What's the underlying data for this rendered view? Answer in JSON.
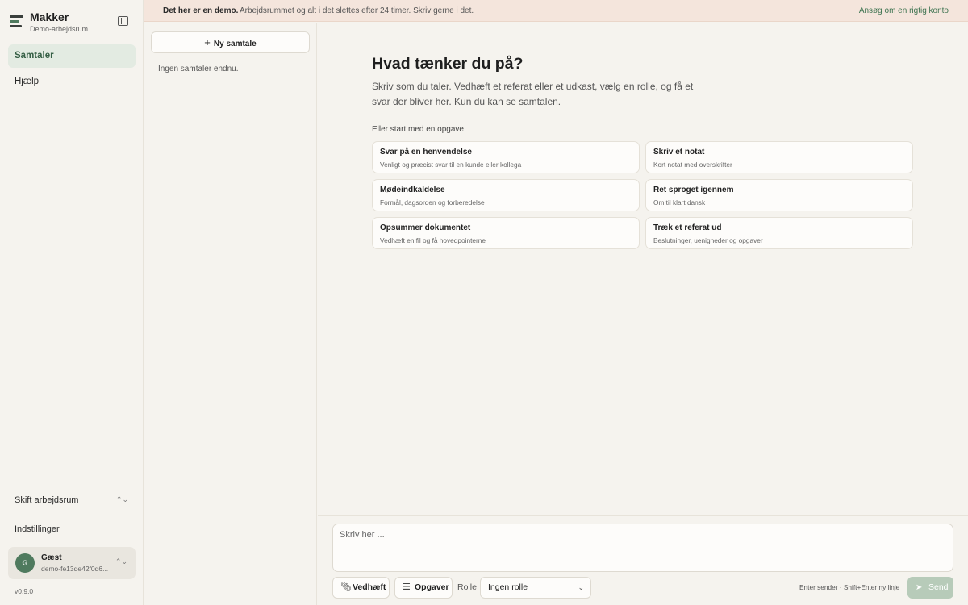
{
  "sidebar": {
    "brand_name": "Makker",
    "brand_sub": "Demo-arbejdsrum",
    "nav": [
      {
        "label": "Samtaler",
        "active": true
      },
      {
        "label": "Hjælp",
        "active": false
      }
    ],
    "switch_workspace": "Skift arbejdsrum",
    "settings": "Indstillinger",
    "user": {
      "initial": "G",
      "name": "Gæst",
      "id": "demo-fe13de42f0d6..."
    },
    "version": "v0.9.0"
  },
  "banner": {
    "strong": "Det her er en demo.",
    "text": "Arbejdsrummet og alt i det slettes efter 24 timer. Skriv gerne i det.",
    "link": "Ansøg om en rigtig konto"
  },
  "conversations": {
    "new_button": "Ny samtale",
    "empty": "Ingen samtaler endnu."
  },
  "main": {
    "title": "Hvad tænker du på?",
    "description": "Skriv som du taler. Vedhæft et referat eller et udkast, vælg en rolle, og få et svar der bliver her. Kun du kan se samtalen.",
    "start_label": "Eller start med en opgave",
    "tasks": [
      {
        "title": "Svar på en henvendelse",
        "sub": "Venligt og præcist svar til en kunde eller kollega"
      },
      {
        "title": "Skriv et notat",
        "sub": "Kort notat med overskrifter"
      },
      {
        "title": "Mødeindkaldelse",
        "sub": "Formål, dagsorden og forberedelse"
      },
      {
        "title": "Ret sproget igennem",
        "sub": "Om til klart dansk"
      },
      {
        "title": "Opsummer dokumentet",
        "sub": "Vedhæft en fil og få hovedpointerne"
      },
      {
        "title": "Træk et referat ud",
        "sub": "Beslutninger, uenigheder og opgaver"
      }
    ]
  },
  "composer": {
    "placeholder": "Skriv her ...",
    "attach": "Vedhæft",
    "tasks": "Opgaver",
    "role_label": "Rolle",
    "role_value": "Ingen rolle",
    "hint": "Enter sender · Shift+Enter ny linje",
    "send": "Send"
  },
  "colors": {
    "accent": "#4f7a5e",
    "banner_bg": "#f4e5dc",
    "active_nav_bg": "#e3ebe2",
    "send_disabled": "#b7cbb9"
  }
}
